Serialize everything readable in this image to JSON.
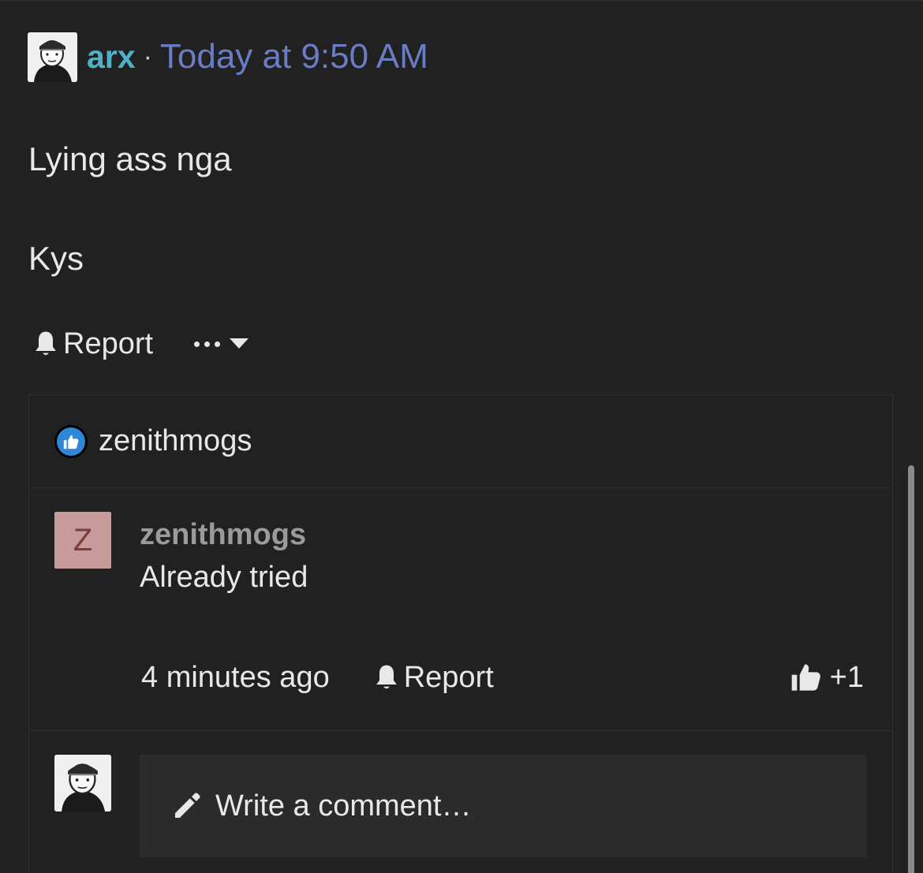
{
  "post": {
    "author": "arx",
    "separator": "·",
    "timestamp": "Today at 9:50 AM",
    "lines": [
      "Lying ass nga",
      "Kys"
    ],
    "report_label": "Report"
  },
  "likes": {
    "names": "zenithmogs"
  },
  "comment": {
    "avatar_letter": "Z",
    "author": "zenithmogs",
    "text": "Already tried",
    "time": "4 minutes ago",
    "report_label": "Report",
    "like_count": "+1"
  },
  "composer": {
    "placeholder": "Write a comment…"
  },
  "colors": {
    "author": "#4fb0c6",
    "timestamp": "#6a7cc6",
    "like_badge": "#2d86d6",
    "avatar_letter_bg": "#c89b9b"
  },
  "icons": {
    "report": "bell-icon",
    "more": "ellipsis-icon",
    "caret": "caret-down-icon",
    "like": "thumbs-up-icon",
    "compose": "pencil-icon"
  }
}
